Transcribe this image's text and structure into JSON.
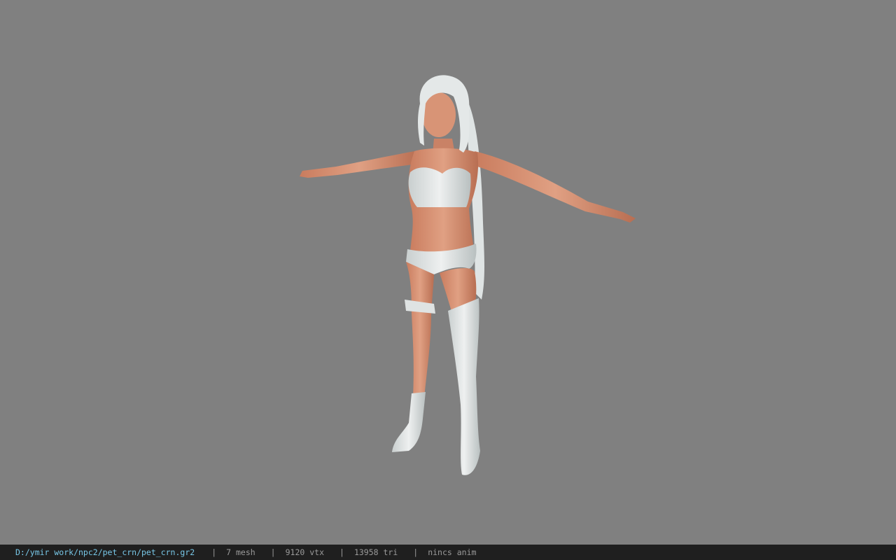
{
  "viewer": {
    "background_color": "#808080",
    "model": {
      "skin_color": "#d89476",
      "outfit_color": "#dfe3e3",
      "hair_color": "#e4e8e8"
    }
  },
  "statusbar": {
    "file_path": "D:/ymir work/npc2/pet_crn/pet_crn.gr2",
    "separator": "|",
    "mesh_count": "7 mesh",
    "vertex_count": "9120 vtx",
    "triangle_count": "13958 tri",
    "anim_status": "nincs anim"
  }
}
